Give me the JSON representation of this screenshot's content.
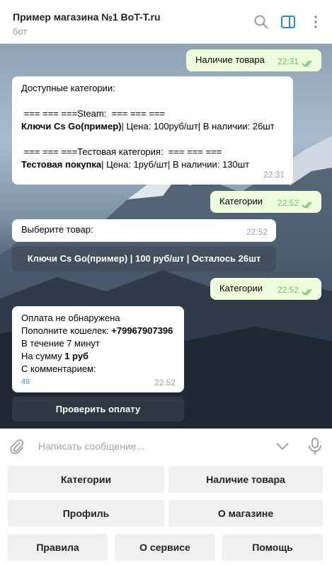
{
  "header": {
    "title": "Пример магазина №1 BoT-T.ru",
    "subtitle": "бот"
  },
  "colors": {
    "outgoing_bubble": "#effdde",
    "incoming_bubble": "#ffffff",
    "time_outgoing": "#6dc265",
    "accent": "#2d8ac7"
  },
  "messages": {
    "m1": {
      "text": "Наличие товара",
      "time": "22:31"
    },
    "m2": {
      "line1": "Доступные категории:",
      "line2": " === === ===Steam:  === === ===",
      "line3_bold": "Ключи Cs Go(пример)",
      "line3_rest": "| Цена: 100руб/шт| В наличии: 26шт",
      "line4": " === === ===Тестовая категория:  === === ===",
      "line5_bold": "Тестовая покупка",
      "line5_rest": "| Цена: 1руб/шт| В наличии: 130шт",
      "time": "22:31"
    },
    "m3": {
      "text": "Категории",
      "time": "22:52"
    },
    "m4": {
      "text": "Выберите товар:",
      "time": "22:52",
      "button": "Ключи Cs Go(пример) | 100 руб/шт | Осталось 26шт"
    },
    "m5": {
      "text": "Категории",
      "time": "22:52"
    },
    "m6": {
      "line1": "Оплата не обнаружена",
      "line2_pre": "Пополните кошелек: ",
      "line2_bold": "+79967907396",
      "line3": "В течение 7 минут",
      "line4_pre": "На сумму ",
      "line4_bold": "1 руб",
      "line5": "С комментарием:",
      "line6": "49",
      "time": "22:52",
      "button": "Проверить оплату"
    }
  },
  "input": {
    "placeholder": "Написать сообщение..."
  },
  "keyboard": {
    "categories": "Категории",
    "stock": "Наличие товара",
    "profile": "Профиль",
    "about_shop": "О магазине",
    "rules": "Правила",
    "about_service": "О сервисе",
    "help": "Помощь"
  },
  "icons": {
    "search": "search-icon",
    "sidebar": "sidebar-toggle-icon",
    "menu": "more-vertical-icon",
    "attach": "paperclip-icon",
    "keyboard_toggle": "chevron-down-icon",
    "mic": "microphone-icon",
    "read": "double-check-icon"
  }
}
